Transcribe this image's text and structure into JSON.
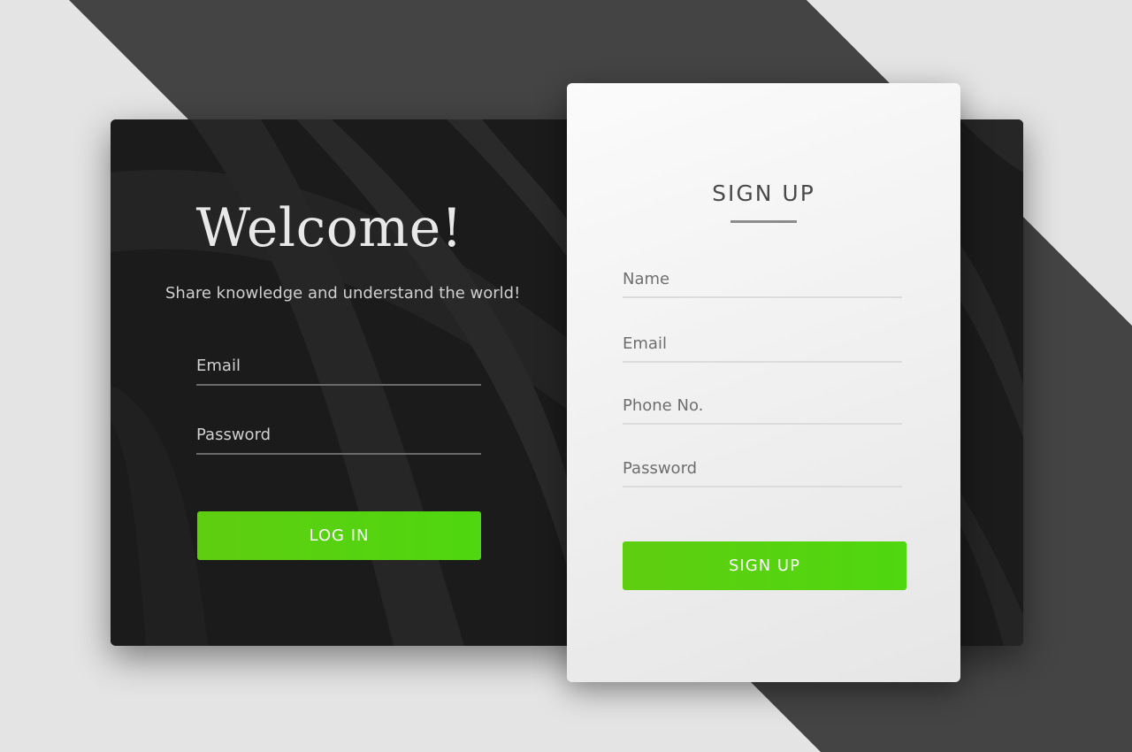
{
  "login": {
    "heading": "Welcome!",
    "tagline": "Share knowledge and understand the world!",
    "email_placeholder": "Email",
    "password_placeholder": "Password",
    "button_label": "LOG IN"
  },
  "signup": {
    "title": "SIGN UP",
    "fields": {
      "name": "Name",
      "email": "Email",
      "phone": "Phone No.",
      "password": "Password"
    },
    "button_label": "SIGN UP"
  },
  "colors": {
    "accent": "#4fd70f",
    "dark_card": "#1c1c1c",
    "stripe": "#444444",
    "page_bg": "#e4e4e4"
  }
}
